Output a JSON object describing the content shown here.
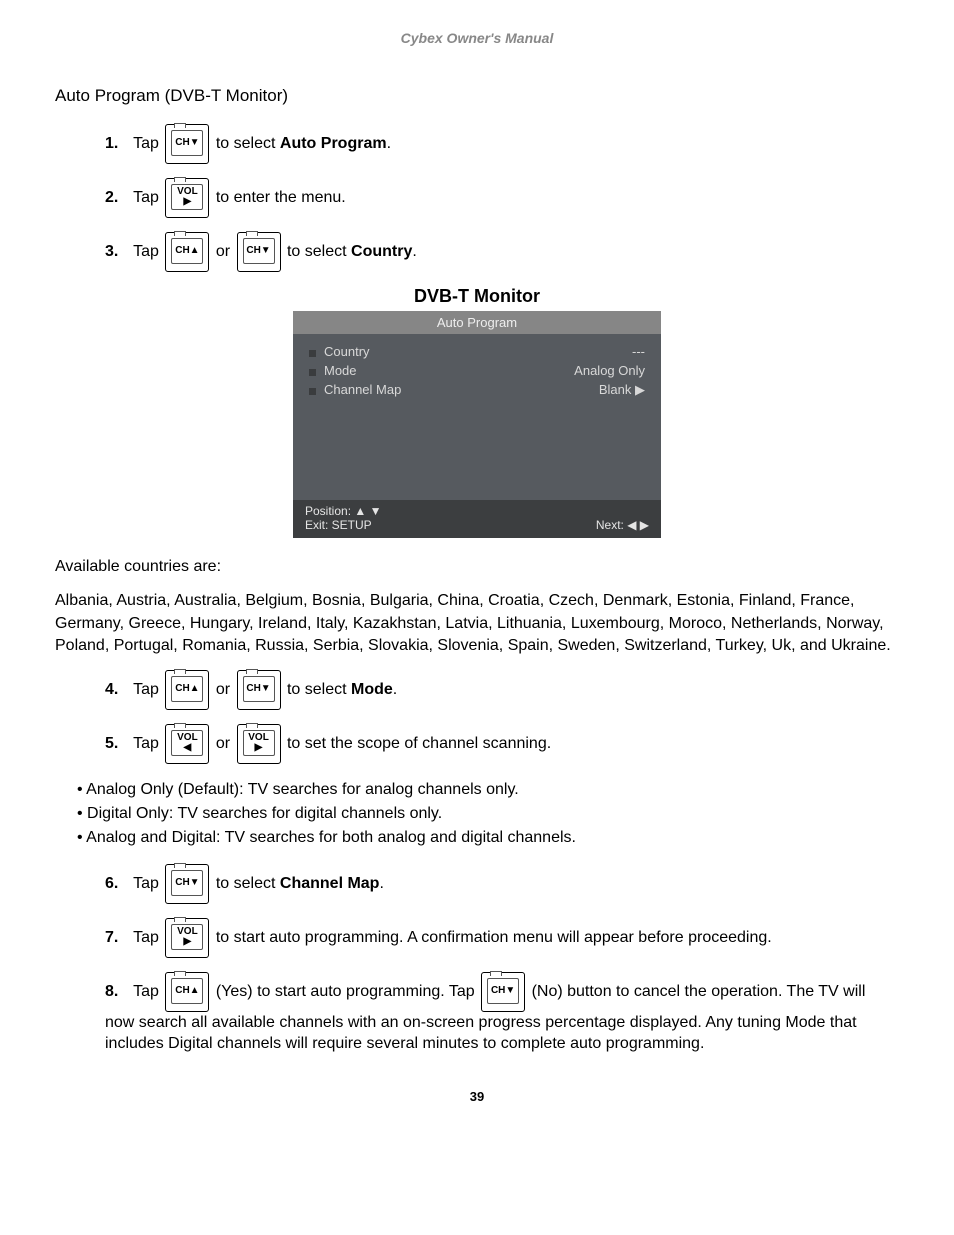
{
  "header": "Cybex Owner's Manual",
  "section_title": "Auto Program (DVB-T Monitor)",
  "steps": {
    "s1": {
      "num": "1.",
      "pre": "Tap ",
      "post": " to select ",
      "bold": "Auto Program",
      "end": "."
    },
    "s2": {
      "num": "2.",
      "pre": "Tap ",
      "post": " to enter the menu."
    },
    "s3": {
      "num": "3.",
      "pre": "Tap ",
      "mid": " or ",
      "post": " to select ",
      "bold": "Country",
      "end": "."
    },
    "s4": {
      "num": "4.",
      "pre": "Tap ",
      "mid": " or ",
      "post": " to select ",
      "bold": "Mode",
      "end": "."
    },
    "s5": {
      "num": "5.",
      "pre": "Tap ",
      "mid": " or ",
      "post": " to set the scope of channel scanning."
    },
    "s6": {
      "num": "6.",
      "pre": "Tap ",
      "post": " to select ",
      "bold": "Channel Map",
      "end": "."
    },
    "s7": {
      "num": "7.",
      "pre": "Tap ",
      "post": " to start auto programming. A confirmation menu will appear before proceeding."
    },
    "s8": {
      "num": "8.",
      "pre": "Tap ",
      "yes": "(Yes) to start auto programming. Tap ",
      "no": "(No) button to cancel the operation. The TV will now search all available channels with an on-screen progress percentage displayed. Any tuning Mode that includes Digital channels will require several minutes to complete auto programming."
    }
  },
  "icons": {
    "ch_down": "CH▼",
    "ch_up": "CH▲",
    "vol_right": "VOL\n▶",
    "vol_left": "VOL\n◀"
  },
  "screen": {
    "title": "DVB-T Monitor",
    "header": "Auto Program",
    "rows": [
      {
        "label": "Country",
        "value": "---"
      },
      {
        "label": "Mode",
        "value": "Analog Only"
      },
      {
        "label": "Channel Map",
        "value": "Blank ▶"
      }
    ],
    "footer": {
      "position": "Position: ▲ ▼",
      "exit": "Exit: SETUP",
      "next": "Next: ◀ ▶"
    }
  },
  "available_label": "Available countries are:",
  "countries_para": "Albania, Austria, Australia, Belgium, Bosnia, Bulgaria, China, Croatia, Czech, Denmark, Estonia, Finland, France, Germany, Greece, Hungary, Ireland, Italy, Kazakhstan, Latvia, Lithuania, Luxembourg, Moroco, Netherlands, Norway, Poland, Portugal, Romania, Russia, Serbia, Slovakia, Slovenia, Spain, Sweden, Switzerland, Turkey, Uk, and Ukraine.",
  "bullets": [
    "Analog Only (Default): TV searches for analog channels only.",
    "Digital Only: TV searches for digital channels only.",
    "Analog and Digital: TV searches for both analog and digital channels."
  ],
  "page_number": "39"
}
